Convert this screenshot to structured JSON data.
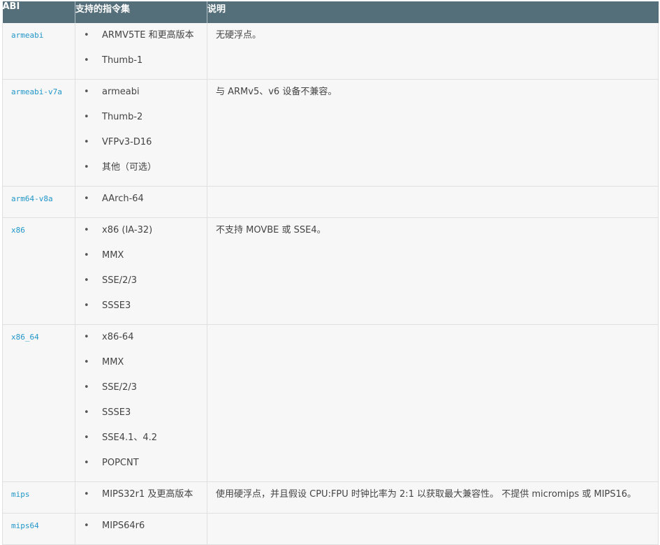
{
  "colors": {
    "header_bg": "#546e7a",
    "header_text": "#ffffff",
    "row_bg": "#f7f7f7",
    "abi_link": "#2196c9",
    "body_text": "#444444"
  },
  "table": {
    "headers": [
      "ABI",
      "支持的指令集",
      "说明"
    ],
    "rows": [
      {
        "abi": "armeabi",
        "isa": [
          "ARMV5TE 和更高版本",
          "Thumb-1"
        ],
        "desc": "无硬浮点。"
      },
      {
        "abi": "armeabi-v7a",
        "isa": [
          "armeabi",
          "Thumb-2",
          "VFPv3-D16",
          "其他（可选）"
        ],
        "desc": "与 ARMv5、v6 设备不兼容。"
      },
      {
        "abi": "arm64-v8a",
        "isa": [
          "AArch-64"
        ],
        "desc": ""
      },
      {
        "abi": "x86",
        "isa": [
          "x86 (IA-32)",
          "MMX",
          "SSE/2/3",
          "SSSE3"
        ],
        "desc": "不支持 MOVBE 或 SSE4。"
      },
      {
        "abi": "x86_64",
        "isa": [
          "x86-64",
          "MMX",
          "SSE/2/3",
          "SSSE3",
          "SSE4.1、4.2",
          "POPCNT"
        ],
        "desc": ""
      },
      {
        "abi": "mips",
        "isa": [
          "MIPS32r1 及更高版本"
        ],
        "desc": "使用硬浮点，并且假设 CPU:FPU 时钟比率为 2:1 以获取最大兼容性。 不提供 micromips 或 MIPS16。"
      },
      {
        "abi": "mips64",
        "isa": [
          "MIPS64r6"
        ],
        "desc": ""
      }
    ]
  }
}
